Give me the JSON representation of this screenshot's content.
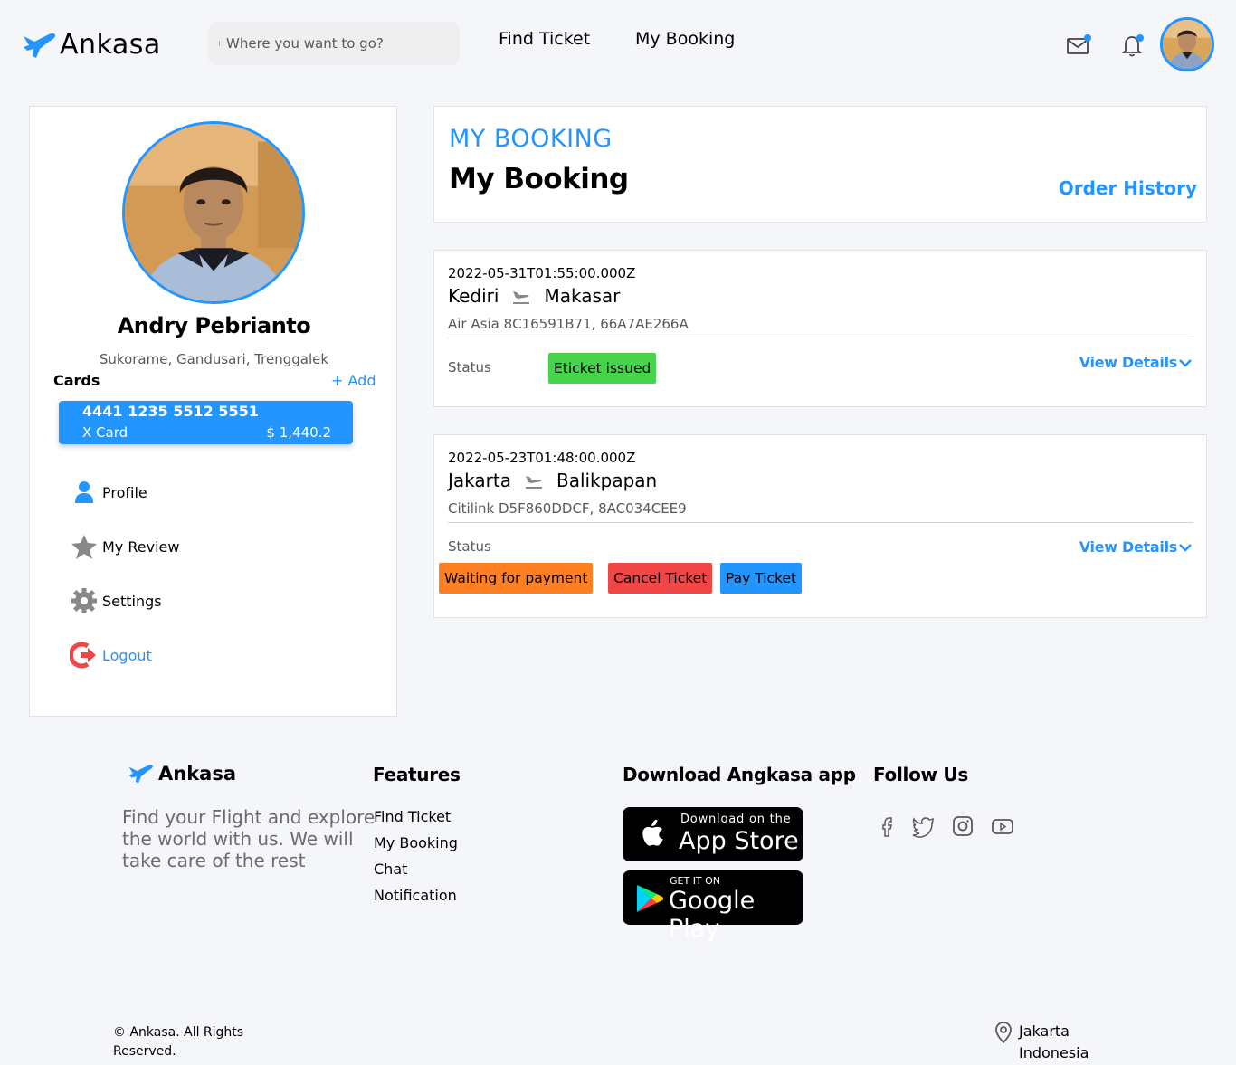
{
  "header": {
    "brand": "Ankasa",
    "search_placeholder": "Where you want to go?",
    "nav": {
      "find_ticket": "Find Ticket",
      "my_booking": "My Booking"
    }
  },
  "profile": {
    "name": "Andry Pebrianto",
    "address": "Sukorame, Gandusari, Trenggalek",
    "cards_label": "Cards",
    "add_label": "+ Add",
    "card": {
      "number": "4441 1235 5512 5551",
      "type": "X Card",
      "balance": "$ 1,440.2"
    },
    "menu": {
      "profile": "Profile",
      "review": "My Review",
      "settings": "Settings",
      "logout": "Logout"
    }
  },
  "booking_header": {
    "small_title": "MY BOOKING",
    "title": "My Booking",
    "order_history": "Order History"
  },
  "bookings": [
    {
      "date": "2022-05-31T01:55:00.000Z",
      "from": "Kediri",
      "to": "Makasar",
      "airline": "Air Asia 8C16591B71, 66A7AE266A",
      "status_label": "Status",
      "status": "Eticket issued",
      "view_details": "View Details"
    },
    {
      "date": "2022-05-23T01:48:00.000Z",
      "from": "Jakarta",
      "to": "Balikpapan",
      "airline": "Citilink D5F860DDCF, 8AC034CEE9",
      "status_label": "Status",
      "status": "Waiting for payment",
      "cancel": "Cancel Ticket",
      "pay": "Pay Ticket",
      "view_details": "View Details"
    }
  ],
  "footer": {
    "brand": "Ankasa",
    "description": "Find your Flight and explore the world with us. We will take care of the rest",
    "features_title": "Features",
    "features": [
      "Find Ticket",
      "My Booking",
      "Chat",
      "Notification"
    ],
    "download_title": "Download Angkasa app",
    "app_store": {
      "line1": "Download on the",
      "line2": "App Store"
    },
    "google_play": {
      "line1": "GET IT ON",
      "line2": "Google Play"
    },
    "follow_title": "Follow Us",
    "copyright": "© Ankasa. All Rights Reserved.",
    "location": {
      "city": "Jakarta",
      "country": "Indonesia"
    }
  },
  "colors": {
    "accent": "#2395ff",
    "status_green": "#47d44b",
    "status_orange": "#ff7f23",
    "status_red": "#f24545"
  },
  "icons": [
    "plane-logo-icon",
    "mail-icon",
    "bell-icon",
    "user-icon",
    "star-icon",
    "gear-icon",
    "logout-icon",
    "flight-icon",
    "chevron-down-icon",
    "facebook-icon",
    "twitter-icon",
    "instagram-icon",
    "youtube-icon",
    "apple-icon",
    "google-play-icon",
    "location-pin-icon"
  ]
}
